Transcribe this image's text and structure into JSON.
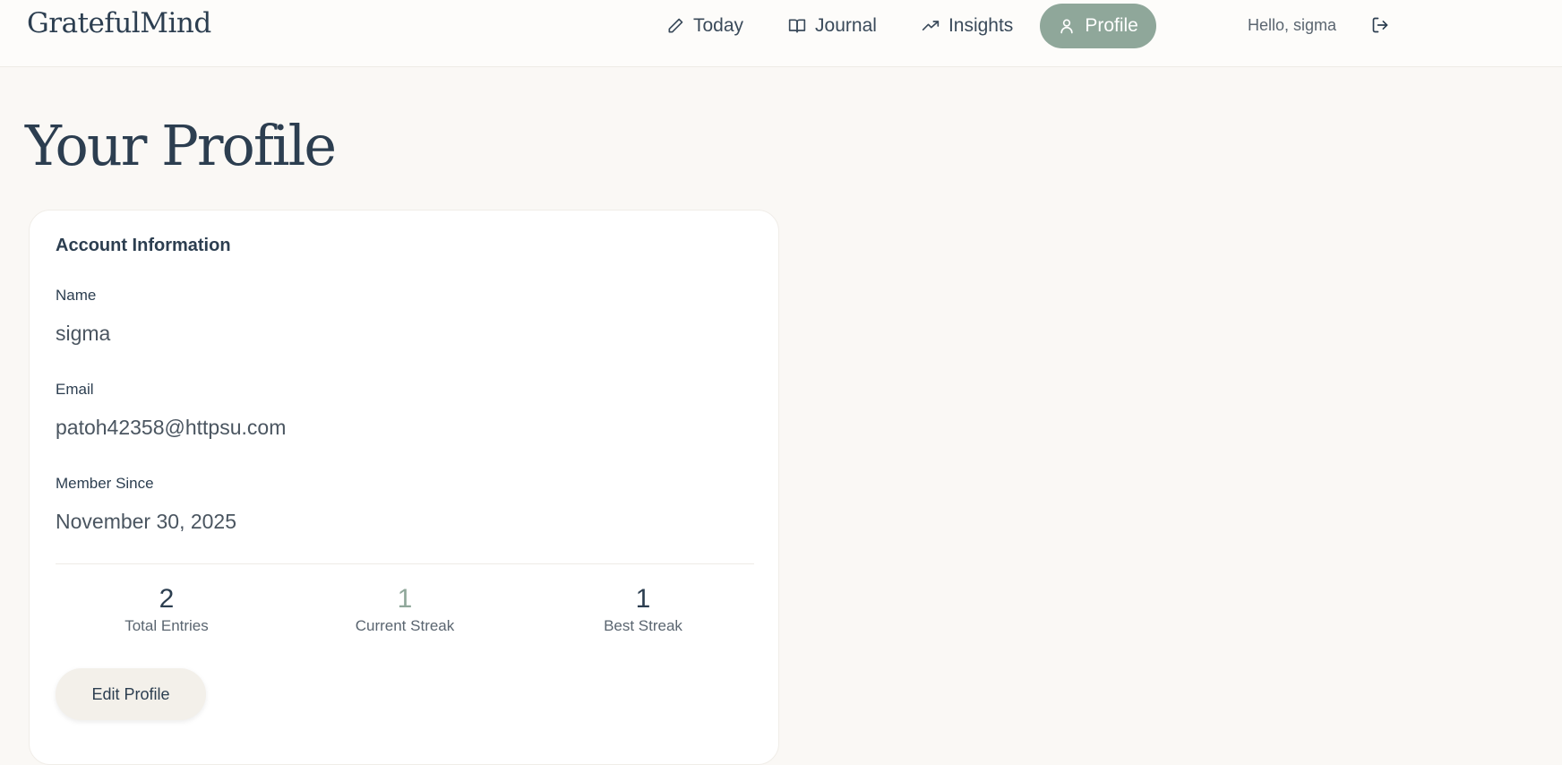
{
  "brand": "GratefulMind",
  "nav": {
    "items": [
      {
        "label": "Today",
        "icon": "pencil-icon"
      },
      {
        "label": "Journal",
        "icon": "book-icon"
      },
      {
        "label": "Insights",
        "icon": "trending-up-icon"
      },
      {
        "label": "Profile",
        "icon": "user-icon",
        "active": true
      }
    ],
    "greeting": "Hello, sigma",
    "logout_icon": "logout-icon"
  },
  "page": {
    "title": "Your Profile"
  },
  "account": {
    "heading": "Account Information",
    "name_label": "Name",
    "name_value": "sigma",
    "email_label": "Email",
    "email_value": "patoh42358@httpsu.com",
    "member_label": "Member Since",
    "member_value": "November 30, 2025"
  },
  "stats": [
    {
      "value": "2",
      "label": "Total Entries"
    },
    {
      "value": "1",
      "label": "Current Streak"
    },
    {
      "value": "1",
      "label": "Best Streak"
    }
  ],
  "actions": {
    "edit_label": "Edit Profile"
  },
  "colors": {
    "accent": "#8fa79a",
    "background": "#faf8f5",
    "text": "#2c3e50"
  }
}
